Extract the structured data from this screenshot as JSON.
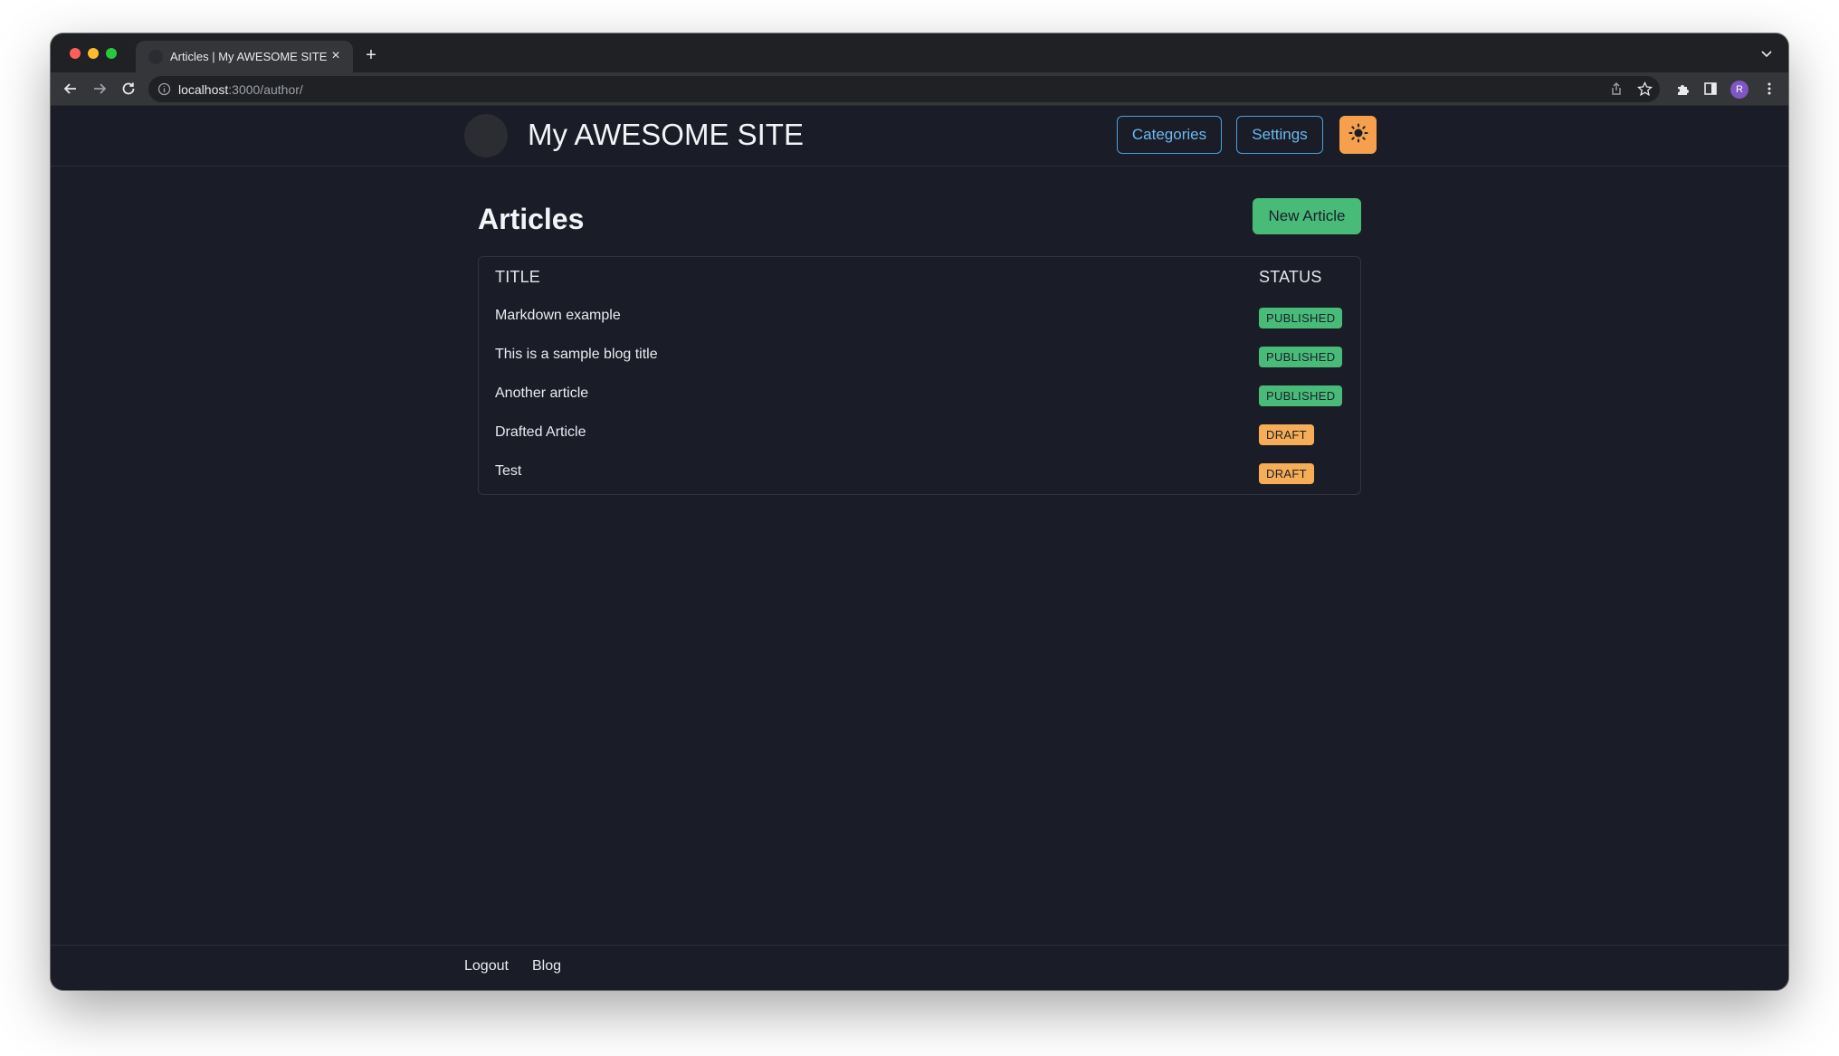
{
  "browser": {
    "tab_title": "Articles | My AWESOME SITE",
    "tab_close": "×",
    "new_tab": "+",
    "url_host": "localhost",
    "url_path": ":3000/author/",
    "profile_initial": "R"
  },
  "header": {
    "site_title": "My AWESOME SITE",
    "nav": [
      {
        "label": "Categories"
      },
      {
        "label": "Settings"
      }
    ],
    "theme_icon": "sun-icon"
  },
  "main": {
    "heading": "Articles",
    "new_article_label": "New Article",
    "table": {
      "columns": [
        "TITLE",
        "STATUS"
      ],
      "rows": [
        {
          "title": "Markdown example",
          "status": "PUBLISHED"
        },
        {
          "title": "This is a sample blog title",
          "status": "PUBLISHED"
        },
        {
          "title": "Another article",
          "status": "PUBLISHED"
        },
        {
          "title": "Drafted Article",
          "status": "DRAFT"
        },
        {
          "title": "Test",
          "status": "DRAFT"
        }
      ]
    }
  },
  "footer": {
    "links": [
      {
        "label": "Logout"
      },
      {
        "label": "Blog"
      }
    ]
  },
  "colors": {
    "page_bg": "#1a1d27",
    "published": "#48bb78",
    "draft": "#f6ad55",
    "accent_outline": "#4c9fdb",
    "theme_toggle": "#f6a04d"
  }
}
